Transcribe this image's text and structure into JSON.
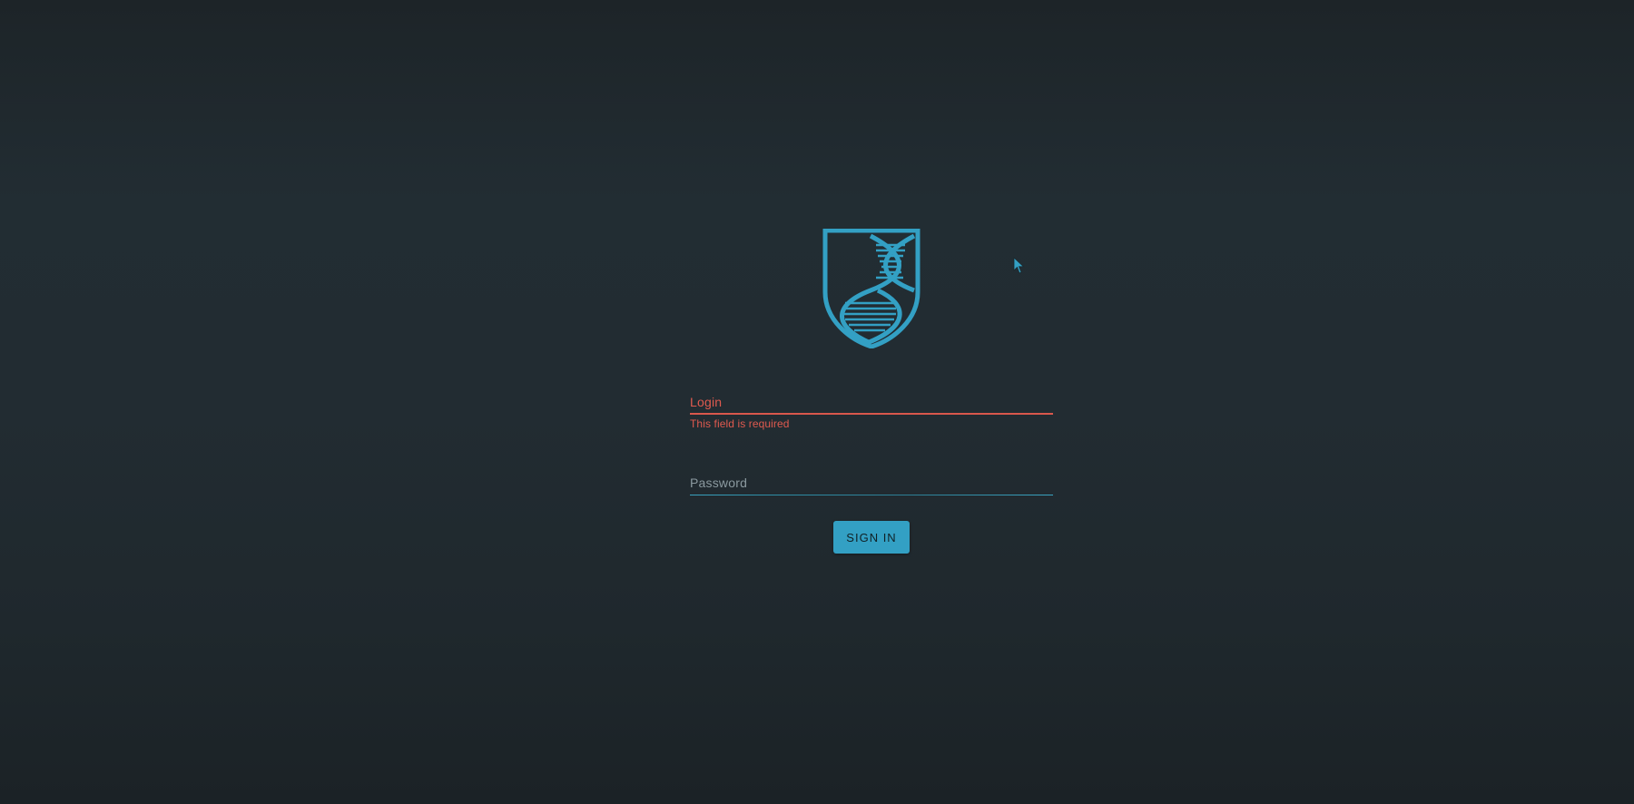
{
  "theme": {
    "accent": "#33a0c4",
    "error": "#e05a4f",
    "background": "#222c32"
  },
  "logo": {
    "icon": "dna-shield-icon"
  },
  "form": {
    "login": {
      "label": "Login",
      "value": "",
      "error": "This field is required"
    },
    "password": {
      "label": "Password",
      "value": ""
    },
    "submit_label": "SIGN IN"
  },
  "cursor": {
    "icon": "pointer-arrow-icon"
  }
}
